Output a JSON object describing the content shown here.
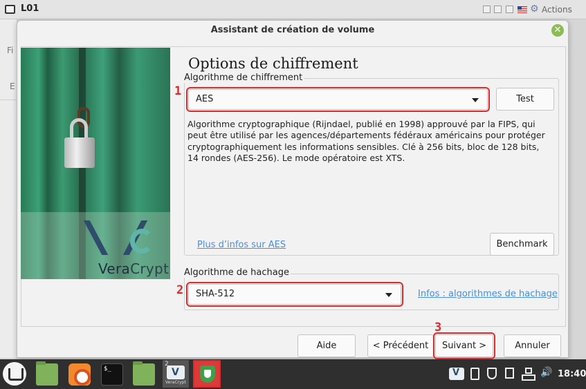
{
  "window": {
    "title": "L01",
    "actions_label": "Actions"
  },
  "background_app": {
    "menu_fragment_1": "Fi",
    "menu_fragment_2": "E"
  },
  "dialog": {
    "title": "Assistant de création de volume",
    "close_icon": "close-icon",
    "page_heading": "Options de chiffrement",
    "image": {
      "logo_text_1": "Vera",
      "logo_text_2": "Crypt"
    },
    "encryption": {
      "legend": "Algorithme de chiffrement",
      "selected": "AES",
      "test_label": "Test",
      "description": "Algorithme cryptographique (Rijndael, publié en 1998) approuvé par la FIPS, qui peut être utilisé par les agences/départements fédéraux américains pour protéger cryptographiquement les informations sensibles. Clé à 256 bits, bloc de 128 bits, 14 rondes (AES-256). Le mode opératoire est XTS.",
      "more_info_link": "Plus d’infos sur AES",
      "benchmark_label": "Benchmark"
    },
    "hash": {
      "legend": "Algorithme de hachage",
      "selected": "SHA-512",
      "info_link": "Infos : algorithmes de hachage"
    },
    "buttons": {
      "help": "Aide",
      "previous": "< Précédent",
      "next": "Suivant >",
      "cancel": "Annuler"
    },
    "annotations": [
      "1",
      "2",
      "3"
    ],
    "highlight_color": "#e02a2a"
  },
  "taskbar": {
    "veracrypt_window_count": "2",
    "veracrypt_label": "VeraCrypt",
    "terminal_prompt": "$_",
    "clock": "18:40",
    "items": [
      "mint-menu-icon",
      "folder-icon",
      "firefox-icon",
      "terminal-icon",
      "folder-icon",
      "veracrypt-icon",
      "shield-app-icon"
    ],
    "tray": [
      "veracrypt-tray-icon",
      "clipboard-icon",
      "shield-icon",
      "eject-icon",
      "network-icon",
      "volume-icon"
    ]
  }
}
